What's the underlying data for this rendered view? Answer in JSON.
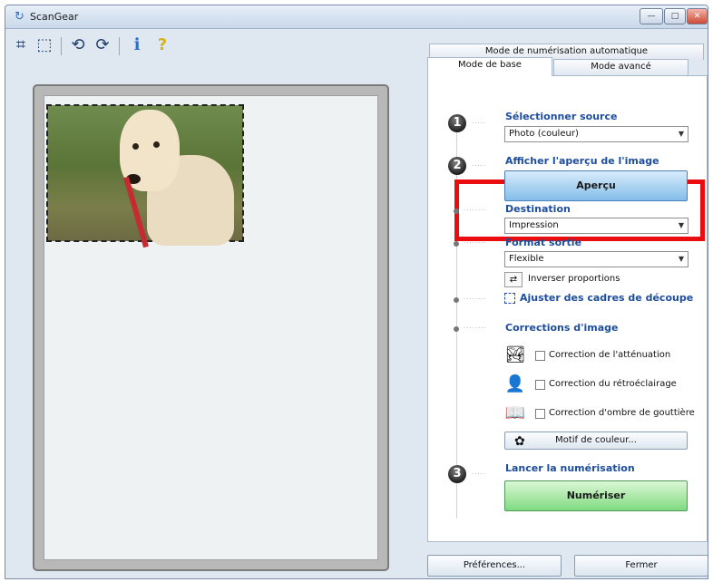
{
  "window": {
    "title": "ScanGear",
    "minimize_label": "—",
    "maximize_label": "□",
    "close_label": "✕"
  },
  "toolbar": {
    "crop_icon": "⌗",
    "crop_remove_icon": "⬚",
    "rotate_left_icon": "⟲",
    "rotate_right_icon": "⟳",
    "info_icon": "ℹ",
    "help_icon": "?"
  },
  "tabs": {
    "auto_scan": "Mode de numérisation automatique",
    "basic": "Mode de base",
    "advanced": "Mode avancé"
  },
  "steps": {
    "step1": {
      "number": "1",
      "label": "Sélectionner source",
      "select_value": "Photo (couleur)"
    },
    "step2": {
      "number": "2",
      "label": "Afficher l'aperçu de l'image",
      "preview_button": "Aperçu"
    },
    "destination": {
      "label": "Destination",
      "select_value": "Impression"
    },
    "output_format": {
      "label": "Format sortie",
      "select_value": "Flexible",
      "invert_label": "Inverser proportions"
    },
    "crop": {
      "label": "Ajuster des cadres de découpe"
    },
    "corrections": {
      "label": "Corrections d'image",
      "fade": "Correction de l'atténuation",
      "backlight": "Correction du rétroéclairage",
      "gutter": "Correction d'ombre de gouttière",
      "color_pattern_button": "Motif de couleur..."
    },
    "step3": {
      "number": "3",
      "label": "Lancer la numérisation",
      "scan_button": "Numériser"
    }
  },
  "footer": {
    "preferences_button": "Préférences...",
    "close_button": "Fermer"
  },
  "colors": {
    "highlight": "#ea0d10",
    "preview_blue": "#83bde9",
    "scan_green": "#7fdb80",
    "label_blue": "#1d4d9c"
  }
}
